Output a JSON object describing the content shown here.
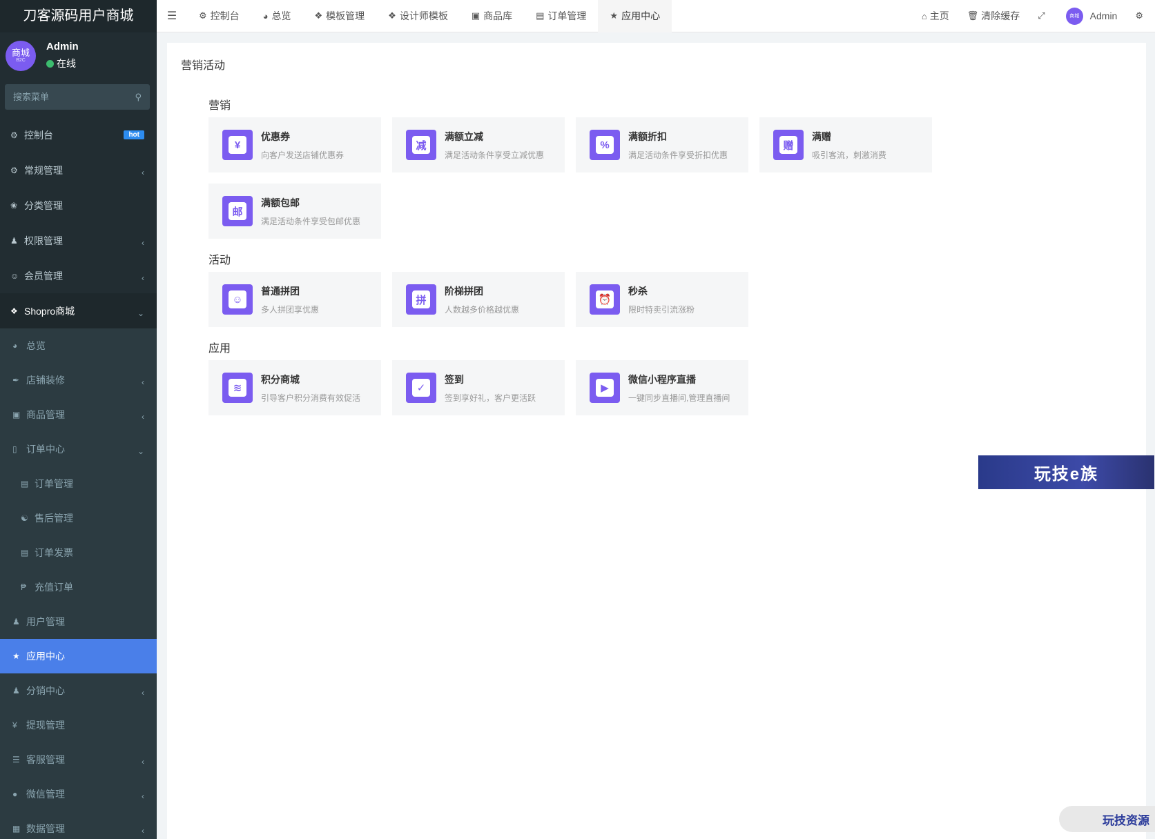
{
  "brand": "刀客源码用户商城",
  "user": {
    "avatar_text": "商城",
    "avatar_sub": "B2C",
    "name": "Admin",
    "status": "在线",
    "status_color": "#3cbc6e"
  },
  "sidebar": {
    "search_placeholder": "搜索菜单",
    "top_items": [
      {
        "label": "控制台",
        "badge": "hot"
      },
      {
        "label": "常规管理"
      },
      {
        "label": "分类管理"
      },
      {
        "label": "权限管理"
      },
      {
        "label": "会员管理"
      }
    ],
    "shopro_label": "Shopro商城",
    "shopro_items": [
      "总览",
      "店铺装修",
      "商品管理",
      "订单中心"
    ],
    "order_items": [
      "订单管理",
      "售后管理",
      "订单发票",
      "充值订单"
    ],
    "rest_items": [
      "用户管理",
      "应用中心",
      "分销中心",
      "提现管理",
      "客服管理",
      "微信管理",
      "数据管理"
    ]
  },
  "topbar": {
    "tabs": [
      "控制台",
      "总览",
      "模板管理",
      "设计师模板",
      "商品库",
      "订单管理",
      "应用中心"
    ],
    "home": "主页",
    "clear_cache": "清除缓存",
    "admin": "Admin"
  },
  "panel": {
    "title": "营销活动",
    "sections": [
      {
        "title": "营销",
        "cards": [
          {
            "icon": "coupon-icon",
            "glyph": "¥",
            "title": "优惠券",
            "desc": "向客户发送店铺优惠券"
          },
          {
            "icon": "discount-reduce-icon",
            "glyph": "减",
            "title": "满额立减",
            "desc": "满足活动条件享受立减优惠"
          },
          {
            "icon": "percent-icon",
            "glyph": "%",
            "title": "满额折扣",
            "desc": "满足活动条件享受折扣优惠"
          },
          {
            "icon": "gift-icon",
            "glyph": "赠",
            "title": "满赠",
            "desc": "吸引客流，刺激消费"
          },
          {
            "icon": "free-shipping-icon",
            "glyph": "邮",
            "title": "满额包邮",
            "desc": "满足活动条件享受包邮优惠"
          }
        ]
      },
      {
        "title": "活动",
        "cards": [
          {
            "icon": "group-buy-icon",
            "glyph": "☺",
            "title": "普通拼团",
            "desc": "多人拼团享优惠"
          },
          {
            "icon": "tier-group-icon",
            "glyph": "拼",
            "title": "阶梯拼团",
            "desc": "人数越多价格越优惠"
          },
          {
            "icon": "alarm-clock-icon",
            "glyph": "⏰",
            "title": "秒杀",
            "desc": "限时特卖引流涨粉"
          }
        ]
      },
      {
        "title": "应用",
        "cards": [
          {
            "icon": "points-mall-icon",
            "glyph": "≋",
            "title": "积分商城",
            "desc": "引导客户积分消费有效促活"
          },
          {
            "icon": "checkin-icon",
            "glyph": "✓",
            "title": "签到",
            "desc": "签到享好礼，客户更活跃"
          },
          {
            "icon": "live-stream-icon",
            "glyph": "▶",
            "title": "微信小程序直播",
            "desc": "一键同步直播间,管理直播间"
          }
        ]
      }
    ]
  },
  "watermarks": {
    "wm1": "玩技e族",
    "wm2": "玩技资源"
  }
}
